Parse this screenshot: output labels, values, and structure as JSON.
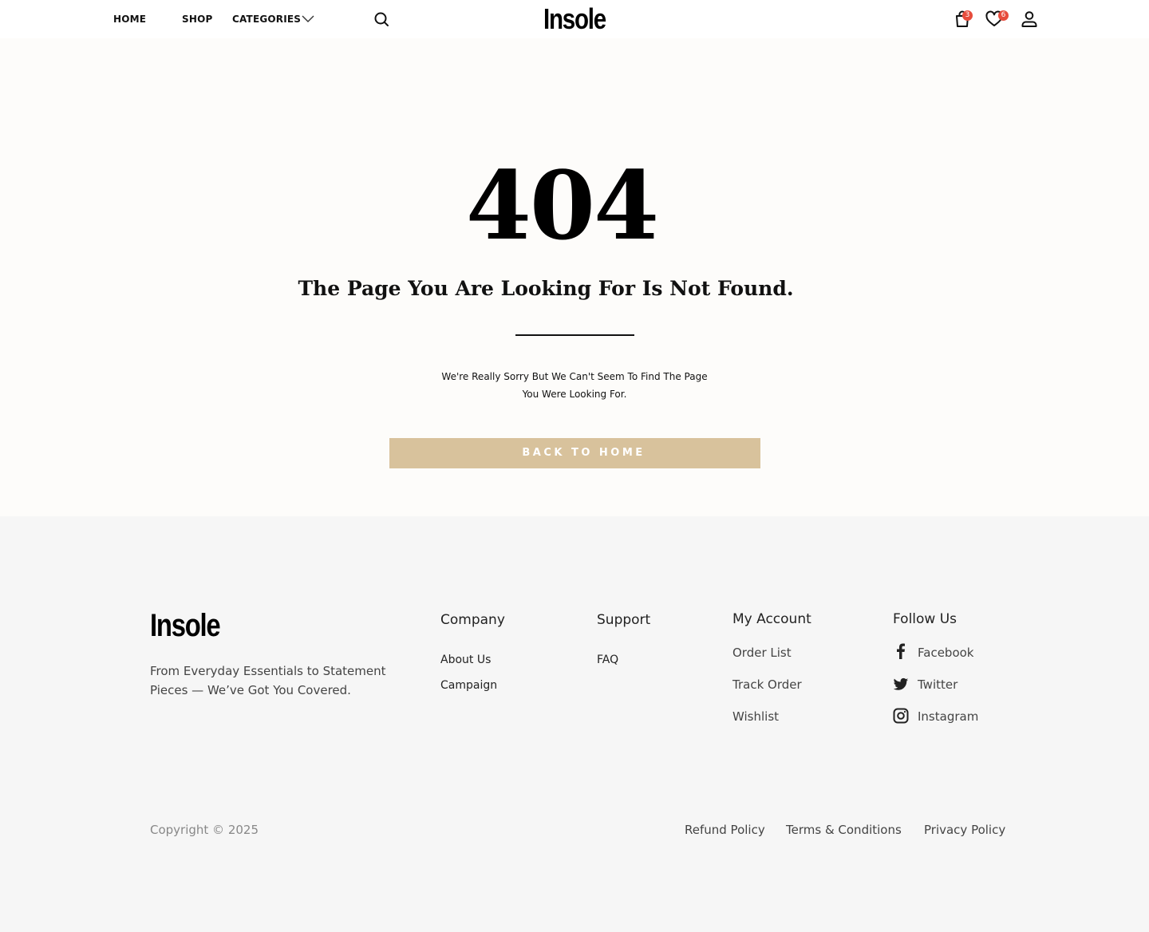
{
  "header": {
    "nav": {
      "home": "HOME",
      "shop": "SHOP",
      "categories": "CATEGORIES"
    },
    "brand": "Insole",
    "cart_count": "3",
    "wishlist_count": "6"
  },
  "error": {
    "code": "404",
    "title": "The Page You Are Looking For Is Not Found.",
    "message_line1": "We're Really Sorry But We Can't Seem To Find The Page",
    "message_line2": "You Were Looking For.",
    "button": "BACK TO HOME"
  },
  "footer": {
    "brand": "Insole",
    "description": "From Everyday Essentials to Statement Pieces — We’ve Got You Covered.",
    "company": {
      "heading": "Company",
      "links": [
        "About Us",
        "Campaign"
      ]
    },
    "support": {
      "heading": "Support",
      "links": [
        "FAQ"
      ]
    },
    "account": {
      "heading": "My Account",
      "links": [
        "Order List",
        "Track Order",
        "Wishlist"
      ]
    },
    "follow": {
      "heading": "Follow Us",
      "links": [
        "Facebook",
        "Twitter",
        "Instagram"
      ]
    },
    "copyright": "Copyright © 2025",
    "legal": [
      "Refund Policy",
      "Terms & Conditions",
      "Privacy Policy"
    ]
  },
  "colors": {
    "accent_button": "#d8c29c",
    "badge": "#e74c3c",
    "page_bg": "#fdfcfa",
    "footer_bg": "#f6f6f6"
  },
  "icons": [
    "chevron-down-icon",
    "search-icon",
    "shopping-bag-icon",
    "heart-icon",
    "user-icon",
    "facebook-icon",
    "twitter-icon",
    "instagram-icon"
  ]
}
